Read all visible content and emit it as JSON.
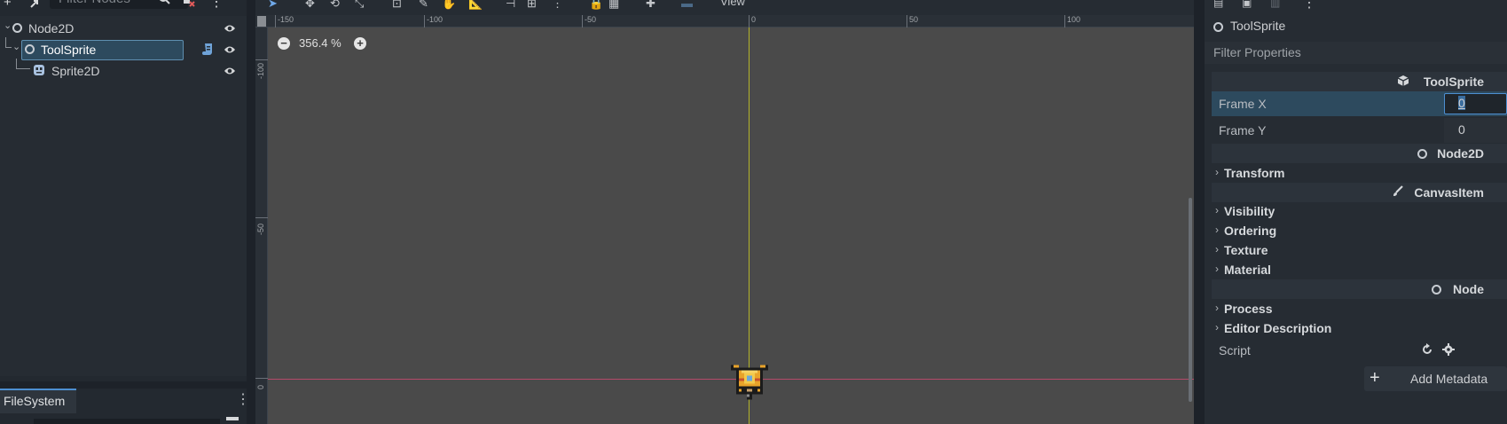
{
  "scene_dock": {
    "filter_placeholder": "Filter Nodes",
    "tree": [
      {
        "label": "Node2D",
        "icon": "node2d-icon"
      },
      {
        "label": "ToolSprite",
        "icon": "node2d-icon",
        "selected": true,
        "has_script": true
      },
      {
        "label": "Sprite2D",
        "icon": "sprite2d-icon"
      }
    ]
  },
  "filesystem": {
    "tab_label": "FileSystem"
  },
  "viewport": {
    "menu_view": "View",
    "zoom_label": "356.4 %",
    "ruler_top_labels": [
      "-150",
      "-100",
      "-50",
      "0",
      "50",
      "100"
    ],
    "ruler_left_labels": [
      "-100",
      "-50",
      "0"
    ]
  },
  "inspector": {
    "object_name": "ToolSprite",
    "filter_placeholder": "Filter Properties",
    "sections": {
      "toolsprite": "ToolSprite",
      "node2d": "Node2D",
      "canvasitem": "CanvasItem",
      "node": "Node"
    },
    "props": {
      "frame_x_label": "Frame X",
      "frame_x_value": "0",
      "frame_y_label": "Frame Y",
      "frame_y_value": "0",
      "script_label": "Script"
    },
    "categories": {
      "transform": "Transform",
      "visibility": "Visibility",
      "ordering": "Ordering",
      "texture": "Texture",
      "material": "Material",
      "process": "Process",
      "editor_description": "Editor Description"
    },
    "add_metadata_label": "Add Metadata"
  },
  "colors": {
    "selection": "#2d4a5e",
    "accent": "#4d8fd1",
    "y_axis": "#b4b42a",
    "x_axis": "#b44a6a"
  }
}
